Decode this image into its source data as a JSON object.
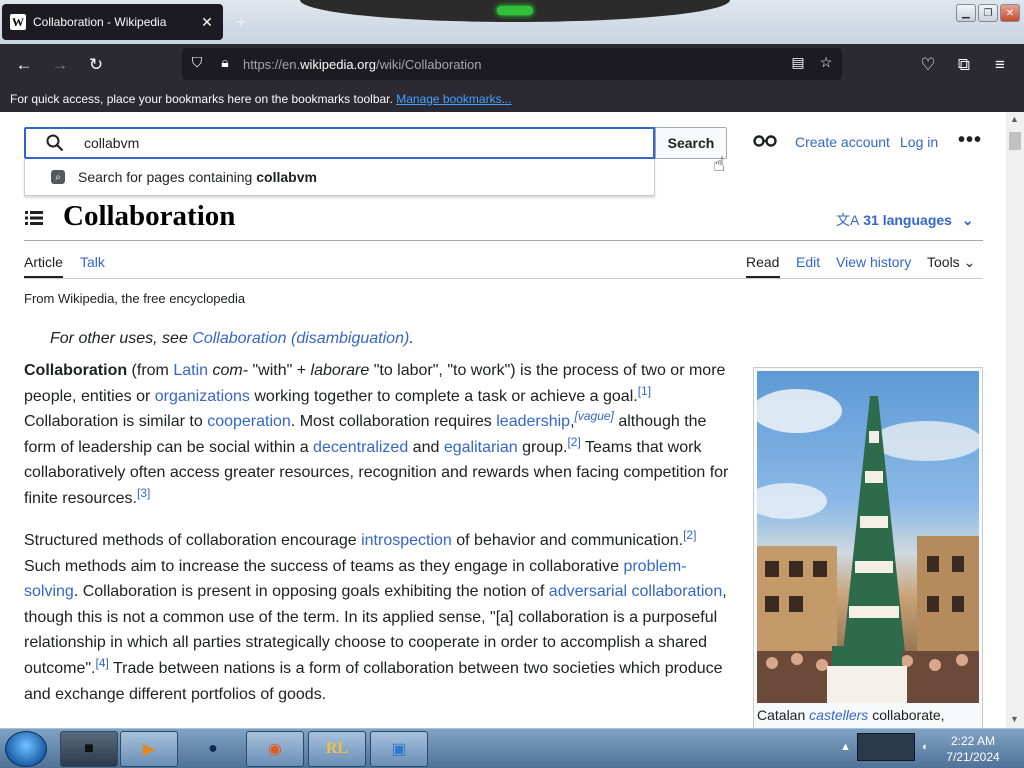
{
  "browser": {
    "tab_title": "Collaboration - Wikipedia",
    "url_prefix": "https://en.",
    "url_domain": "wikipedia.org",
    "url_path": "/wiki/Collaboration",
    "bookmarks_text": "For quick access, place your bookmarks here on the bookmarks toolbar.",
    "bookmarks_link": "Manage bookmarks..."
  },
  "header": {
    "search_value": "collabvm",
    "search_button": "Search",
    "suggest_prefix": "Search for pages containing",
    "suggest_term": "collabvm",
    "create_account": "Create account",
    "log_in": "Log in"
  },
  "article": {
    "title": "Collaboration",
    "languages": "31 languages",
    "tabs": {
      "article": "Article",
      "talk": "Talk",
      "read": "Read",
      "edit": "Edit",
      "history": "View history",
      "tools": "Tools"
    },
    "tagline": "From Wikipedia, the free encyclopedia",
    "hatnote_prefix": "For other uses, see",
    "hatnote_link": "Collaboration (disambiguation)",
    "caption_prefix": "Catalan",
    "caption_link": "castellers",
    "caption_suffix": "collaborate,"
  },
  "p1": {
    "bold": "Collaboration",
    "t1": " (from ",
    "l_latin": "Latin",
    "t2": " ",
    "i_com": "com-",
    "t3": " \"with\" + ",
    "i_laborare": "laborare",
    "t4": " \"to labor\", \"to work\") is the process of two or more people, entities or ",
    "l_org": "organizations",
    "t5": " working together to complete a task or achieve a goal.",
    "r1": "[1]",
    "t6": " Collaboration is similar to ",
    "l_coop": "cooperation",
    "t7": ". Most collaboration requires ",
    "l_lead": "leadership",
    "t8": ",",
    "r_vague": "[vague]",
    "t9": " although the form of leadership can be social within a ",
    "l_decent": "decentralized",
    "t10": " and ",
    "l_egal": "egalitarian",
    "t11": " group.",
    "r2": "[2]",
    "t12": " Teams that work collaboratively often access greater resources, recognition and rewards when facing competition for finite resources.",
    "r3": "[3]"
  },
  "p2": {
    "t1": "Structured methods of collaboration encourage ",
    "l_intro": "introspection",
    "t2": " of behavior and communication.",
    "r2": "[2]",
    "t3": " Such methods aim to increase the success of teams as they engage in collaborative ",
    "l_problem": "problem-solving",
    "t4": ". Collaboration is present in opposing goals exhibiting the notion of ",
    "l_adv": "adversarial collaboration",
    "t5": ", though this is not a common use of the term. In its applied sense, \"[a] collaboration is a purposeful relationship in which all parties strategically choose to cooperate in order to accomplish a shared outcome\".",
    "r4": "[4]",
    "t6": " Trade between nations is a form of collaboration between two societies which produce and exchange different portfolios of goods."
  },
  "taskbar": {
    "time": "2:22 AM",
    "date": "7/21/2024"
  }
}
